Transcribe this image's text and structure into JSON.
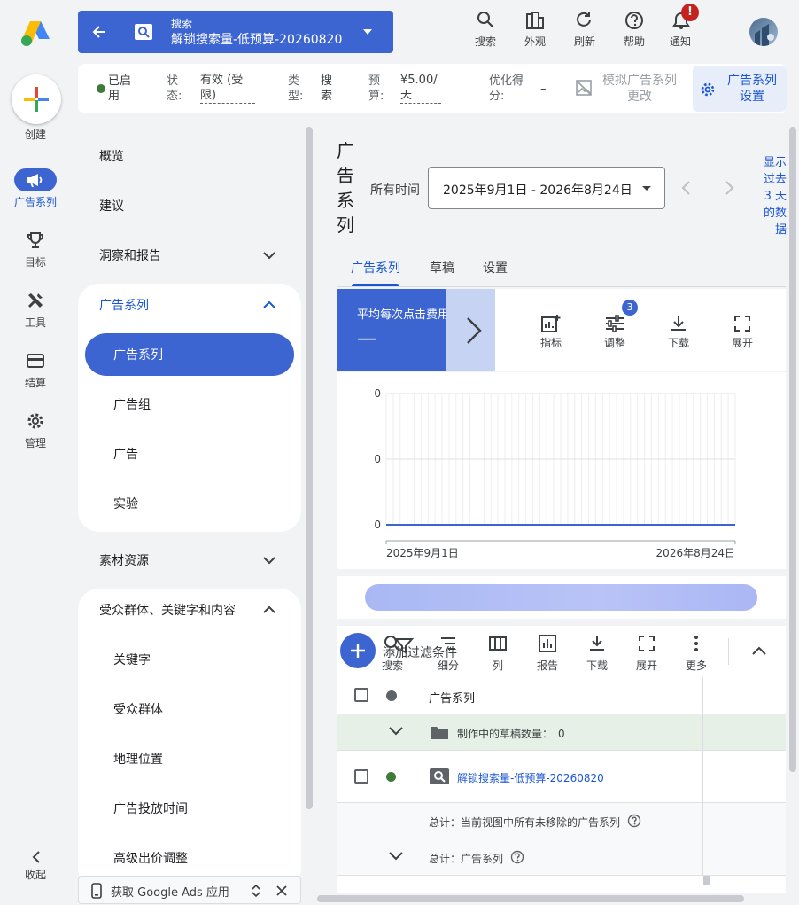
{
  "rail": {
    "create": "创建",
    "items": [
      {
        "label": "广告系列",
        "icon": "megaphone-icon",
        "active": true
      },
      {
        "label": "目标",
        "icon": "trophy-icon",
        "active": false
      },
      {
        "label": "工具",
        "icon": "tools-icon",
        "active": false
      },
      {
        "label": "结算",
        "icon": "card-icon",
        "active": false
      },
      {
        "label": "管理",
        "icon": "gear-icon",
        "active": false
      }
    ],
    "collapse": "收起"
  },
  "header": {
    "campaign_type": "搜索",
    "campaign_name": "解锁搜索量-低预算-20260820",
    "buttons": [
      "搜索",
      "外观",
      "刷新",
      "帮助",
      "通知"
    ],
    "notification_badge": "!"
  },
  "status": {
    "enabled": "已启用",
    "state_label": "状态:",
    "state_value": "有效 (受限)",
    "type_label": "类型:",
    "type_value": "搜索",
    "budget_label": "预算:",
    "budget_value": "¥5.00/天",
    "opt_label": "优化得分:",
    "opt_value": "–",
    "simulate": "模拟广告系列更改",
    "settings": "广告系列设置"
  },
  "nav": {
    "overview": "概览",
    "recommendations": "建议",
    "insights": "洞察和报告",
    "campaigns_group": "广告系列",
    "campaigns_sub": [
      "广告系列",
      "广告组",
      "广告",
      "实验"
    ],
    "assets": "素材资源",
    "audience_group": "受众群体、关键字和内容",
    "audience_sub": [
      "关键字",
      "受众群体",
      "地理位置",
      "广告投放时间",
      "高级出价调整"
    ],
    "app_banner": "获取 Google Ads 应用"
  },
  "main": {
    "title": "广告系列",
    "date_label": "所有时间",
    "date_range": "2025年9月1日 - 2026年8月24日",
    "show_link": "显示过去 3 天的数据",
    "tabs": [
      "广告系列",
      "草稿",
      "设置"
    ],
    "metric_label": "平均每次点击费用",
    "metric_value": "—",
    "chart_tools": [
      "指标",
      "调整",
      "下载",
      "展开"
    ],
    "adjust_badge": "3",
    "chart_data": {
      "type": "line",
      "x": [
        "2025年9月1日",
        "2026年8月24日"
      ],
      "y_ticks": [
        "0",
        "0",
        "0"
      ],
      "series": [
        {
          "values": [
            0,
            0
          ]
        }
      ]
    },
    "table_tools": [
      "搜索",
      "细分",
      "列",
      "报告",
      "下载",
      "展开",
      "更多"
    ],
    "filter_placeholder": "添加过滤条件",
    "table": {
      "header": "广告系列",
      "drafts": "制作中的草稿数量：",
      "drafts_count": "0",
      "row_name": "解锁搜索量-低预算-20260820",
      "total_all": "总计：当前视图中所有未移除的广告系列",
      "total_campaigns": "总计：广告系列"
    }
  },
  "colors": {
    "brand": "#3d65d1",
    "link": "#1a56d6",
    "enabled": "#3f7a3b"
  }
}
